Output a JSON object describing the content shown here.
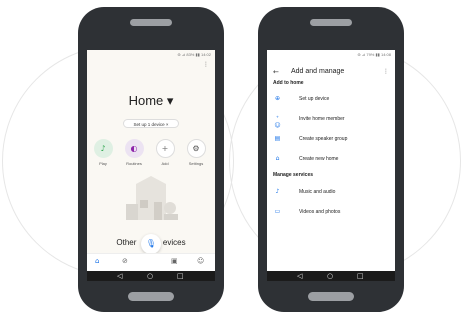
{
  "colors": {
    "accent": "#1a73e8",
    "play": "#34a853",
    "routines": "#8e24aa",
    "phone_body": "#2e3135"
  },
  "left_screen": {
    "status_text": "⊛ ⊿ 83% ▮▮ 14:02",
    "title": "Home ▾",
    "setup_chip": "Set up 1 device ×",
    "actions": [
      {
        "label": "Play",
        "icon": "music-note-icon"
      },
      {
        "label": "Routines",
        "icon": "routines-icon"
      },
      {
        "label": "Add",
        "icon": "plus-icon"
      },
      {
        "label": "Settings",
        "icon": "gear-icon"
      }
    ],
    "section_left": "Other",
    "section_right": "evices",
    "bottom_nav": [
      "home-icon",
      "explore-icon",
      "media-icon",
      "account-icon"
    ]
  },
  "right_screen": {
    "status_text": "⊛ ⊿ 79% ▮▮ 14:08",
    "title": "Add and manage",
    "group1": "Add to home",
    "items1": [
      {
        "label": "Set up device",
        "icon": "plus-circle-icon"
      },
      {
        "label": "Invite home member",
        "icon": "person-add-icon"
      },
      {
        "label": "Create speaker group",
        "icon": "speaker-group-icon"
      },
      {
        "label": "Create new home",
        "icon": "home-icon"
      }
    ],
    "group2": "Manage services",
    "items2": [
      {
        "label": "Music and audio",
        "icon": "music-note-icon"
      },
      {
        "label": "Videos and photos",
        "icon": "video-icon"
      }
    ]
  }
}
